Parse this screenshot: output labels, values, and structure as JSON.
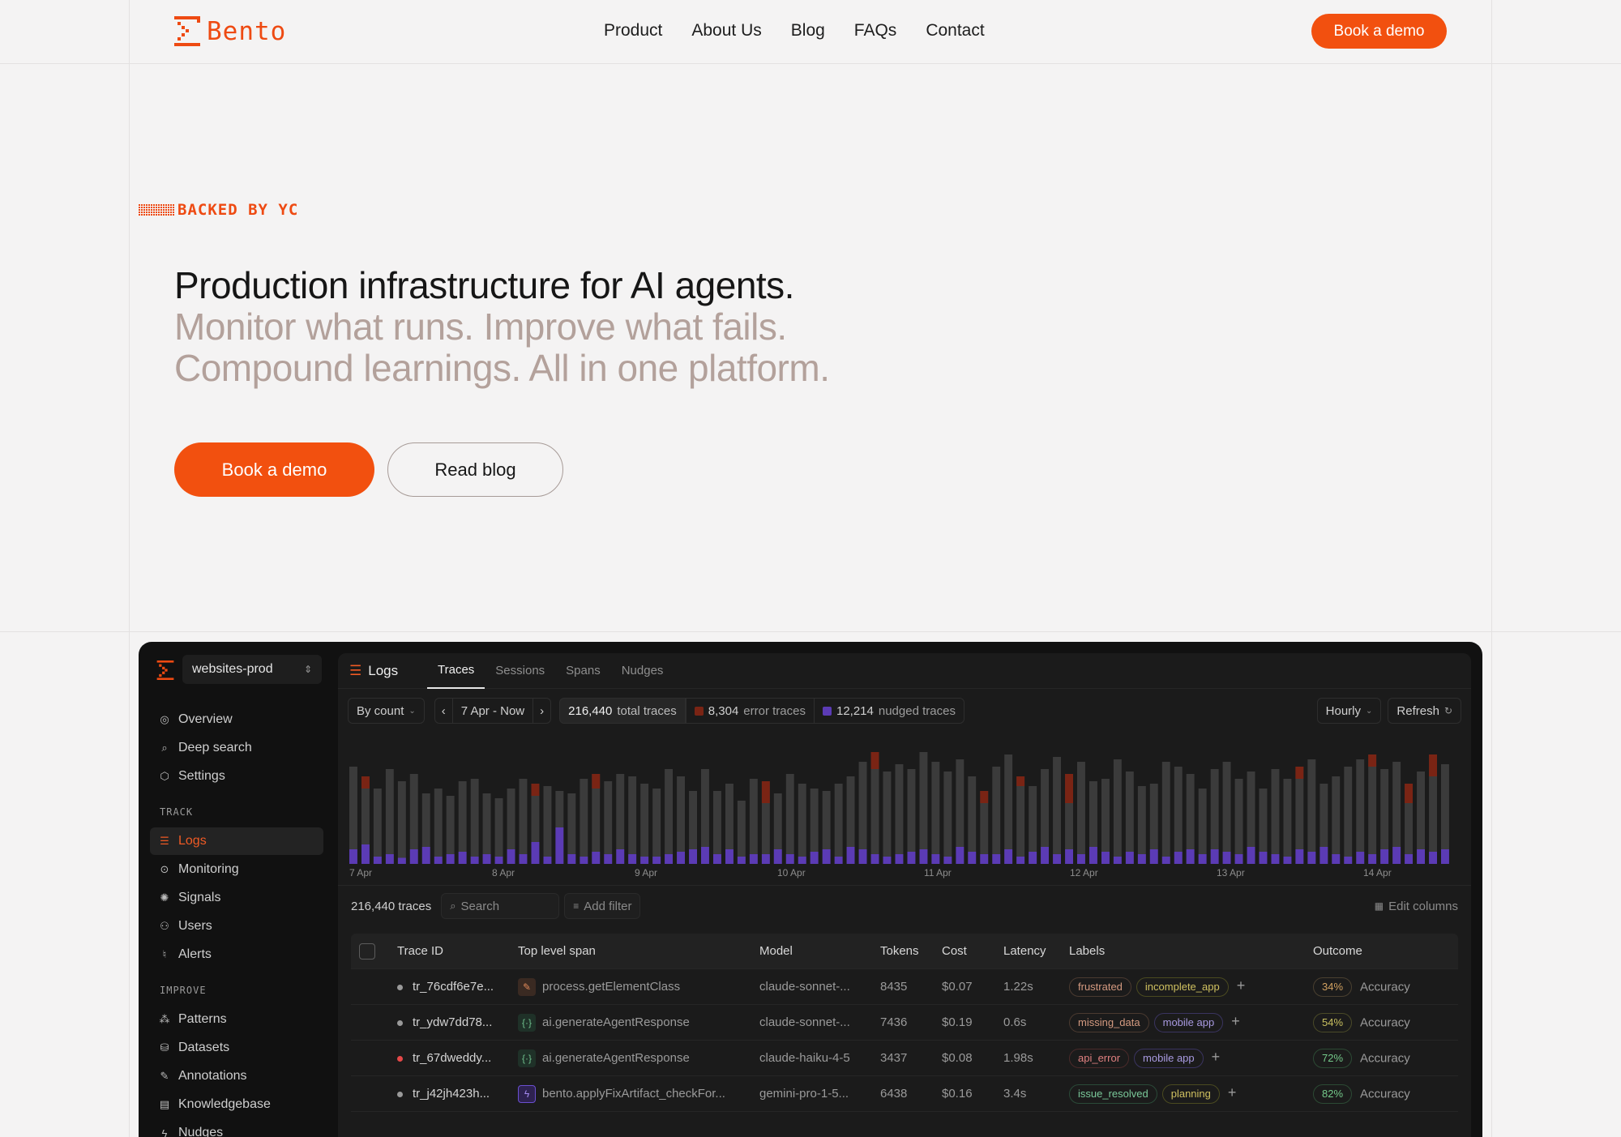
{
  "header": {
    "brand": "Bento",
    "nav": [
      "Product",
      "About Us",
      "Blog",
      "FAQs",
      "Contact"
    ],
    "cta": "Book a demo"
  },
  "hero": {
    "badge": "BACKED BY YC",
    "headline": "Production infrastructure for AI agents.",
    "subline1": "Monitor what runs. Improve what fails.",
    "subline2": "Compound learnings. All in one platform.",
    "primary_button": "Book a demo",
    "secondary_button": "Read blog"
  },
  "colors": {
    "accent": "#f2500f",
    "muted_text": "#b3a19b",
    "error": "#7a2414",
    "nudged": "#5b3bb5"
  },
  "dashboard": {
    "workspace": "websites-prod",
    "sidebar": {
      "top": [
        {
          "label": "Overview",
          "icon": "compass-icon"
        },
        {
          "label": "Deep search",
          "icon": "search-icon"
        },
        {
          "label": "Settings",
          "icon": "settings-icon"
        }
      ],
      "track_heading": "TRACK",
      "track": [
        {
          "label": "Logs",
          "icon": "list-icon",
          "active": true
        },
        {
          "label": "Monitoring",
          "icon": "monitor-icon"
        },
        {
          "label": "Signals",
          "icon": "signal-icon"
        },
        {
          "label": "Users",
          "icon": "users-icon"
        },
        {
          "label": "Alerts",
          "icon": "bell-icon"
        }
      ],
      "improve_heading": "IMPROVE",
      "improve": [
        {
          "label": "Patterns",
          "icon": "patterns-icon"
        },
        {
          "label": "Datasets",
          "icon": "database-icon"
        },
        {
          "label": "Annotations",
          "icon": "annotation-icon"
        },
        {
          "label": "Knowledgebase",
          "icon": "document-icon"
        },
        {
          "label": "Nudges",
          "icon": "bolt-icon"
        }
      ]
    },
    "page_title": "Logs",
    "tabs": [
      "Traces",
      "Sessions",
      "Spans",
      "Nudges"
    ],
    "active_tab": "Traces",
    "controls": {
      "group_by": "By count",
      "date_range": "7 Apr - Now",
      "total_traces": "216,440",
      "total_traces_label": "total traces",
      "error_traces": "8,304",
      "error_traces_label": "error traces",
      "nudged_traces": "12,214",
      "nudged_traces_label": "nudged traces",
      "interval": "Hourly",
      "refresh": "Refresh"
    },
    "list_bar": {
      "count": "216,440 traces",
      "search_placeholder": "Search",
      "add_filter": "Add filter",
      "edit_columns": "Edit columns"
    },
    "table": {
      "columns": [
        "Trace ID",
        "Top level span",
        "Model",
        "Tokens",
        "Cost",
        "Latency",
        "Labels",
        "Outcome"
      ],
      "rows": [
        {
          "status": "ok",
          "trace_id": "tr_76cdf6e7e...",
          "span_icon": "wrench-icon",
          "span": "process.getElementClass",
          "model": "claude-sonnet-...",
          "tokens": "8435",
          "cost": "$0.07",
          "latency": "1.22s",
          "labels": [
            "frustrated",
            "incomplete_app"
          ],
          "pct": "34%",
          "outcome": "Accuracy"
        },
        {
          "status": "ok",
          "trace_id": "tr_ydw7dd78...",
          "span_icon": "braces-icon",
          "span": "ai.generateAgentResponse",
          "model": "claude-sonnet-...",
          "tokens": "7436",
          "cost": "$0.19",
          "latency": "0.6s",
          "labels": [
            "missing_data",
            "mobile app"
          ],
          "pct": "54%",
          "outcome": "Accuracy"
        },
        {
          "status": "error",
          "trace_id": "tr_67dweddy...",
          "span_icon": "braces-icon",
          "span": "ai.generateAgentResponse",
          "model": "claude-haiku-4-5",
          "tokens": "3437",
          "cost": "$0.08",
          "latency": "1.98s",
          "labels": [
            "api_error",
            "mobile app"
          ],
          "pct": "72%",
          "outcome": "Accuracy"
        },
        {
          "status": "ok",
          "trace_id": "tr_j42jh423h...",
          "span_icon": "bolt-icon",
          "span": "bento.applyFixArtifact_checkFor...",
          "model": "gemini-pro-1-5...",
          "tokens": "6438",
          "cost": "$0.16",
          "latency": "3.4s",
          "labels": [
            "issue_resolved",
            "planning"
          ],
          "pct": "82%",
          "outcome": "Accuracy"
        }
      ]
    }
  },
  "chart_data": {
    "type": "bar",
    "x_labels": [
      "7 Apr",
      "8 Apr",
      "9 Apr",
      "10 Apr",
      "11 Apr",
      "12 Apr",
      "13 Apr",
      "14 Apr"
    ],
    "series": [
      {
        "name": "total traces",
        "values": [
          80,
          72,
          62,
          78,
          68,
          74,
          58,
          62,
          56,
          68,
          70,
          58,
          54,
          62,
          70,
          66,
          64,
          60,
          58,
          70,
          74,
          68,
          74,
          72,
          66,
          62,
          78,
          72,
          60,
          78,
          60,
          66,
          52,
          70,
          68,
          58,
          74,
          66,
          62,
          60,
          66,
          72,
          84,
          92,
          76,
          82,
          78,
          92,
          84,
          76,
          86,
          72,
          60,
          80,
          90,
          72,
          64,
          78,
          88,
          74,
          84,
          68,
          70,
          86,
          76,
          64,
          66,
          84,
          80,
          74,
          62,
          78,
          84,
          70,
          76,
          62,
          78,
          70,
          80,
          86,
          66,
          72,
          80,
          86,
          90,
          78,
          84,
          66,
          76,
          90,
          82
        ]
      },
      {
        "name": "error traces",
        "values": [
          0,
          10,
          0,
          0,
          0,
          0,
          0,
          0,
          0,
          0,
          0,
          0,
          0,
          0,
          0,
          10,
          0,
          0,
          0,
          0,
          12,
          0,
          0,
          0,
          0,
          0,
          0,
          0,
          0,
          0,
          0,
          0,
          0,
          0,
          18,
          0,
          0,
          0,
          0,
          0,
          0,
          0,
          0,
          14,
          0,
          0,
          0,
          0,
          0,
          0,
          0,
          0,
          10,
          0,
          0,
          8,
          0,
          0,
          0,
          24,
          0,
          0,
          0,
          0,
          0,
          0,
          0,
          0,
          0,
          0,
          0,
          0,
          0,
          0,
          0,
          0,
          0,
          0,
          10,
          0,
          0,
          0,
          0,
          0,
          10,
          0,
          0,
          16,
          0,
          18,
          0
        ]
      },
      {
        "name": "nudged traces",
        "values": [
          12,
          16,
          6,
          8,
          5,
          12,
          14,
          6,
          8,
          10,
          6,
          8,
          6,
          12,
          8,
          18,
          6,
          30,
          8,
          6,
          10,
          8,
          12,
          8,
          6,
          6,
          8,
          10,
          12,
          14,
          8,
          12,
          6,
          8,
          8,
          12,
          8,
          6,
          10,
          12,
          6,
          14,
          12,
          8,
          6,
          8,
          10,
          12,
          8,
          6,
          14,
          10,
          8,
          8,
          12,
          6,
          10,
          14,
          8,
          12,
          8,
          14,
          10,
          6,
          10,
          8,
          12,
          6,
          10,
          12,
          8,
          12,
          10,
          8,
          14,
          10,
          8,
          6,
          12,
          10,
          14,
          8,
          6,
          10,
          8,
          12,
          14,
          8,
          12,
          10,
          12
        ]
      }
    ]
  }
}
